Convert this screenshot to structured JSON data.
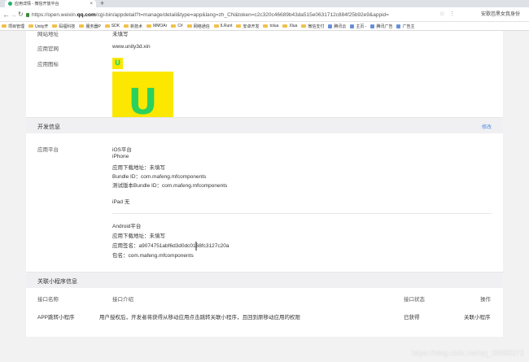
{
  "browser": {
    "tab_title": "应用详情 - 微信开放平台",
    "tab_close": "×",
    "new_tab": "+",
    "url_prefix": "https://open.weixin.",
    "url_domain": "qq.com",
    "url_rest": "/cgi-bin/appdetail?t=manage/detail&type=app&lang=zh_CN&token=c2c320c46689b43da515e0631712c884f25b92e9&appid=",
    "ext_button": "安歌芭黑女我身份",
    "bookmarks": [
      "项目管理",
      "Unity开",
      "码福科技",
      "服务器P",
      "SDK",
      "新技术",
      "MMOAr",
      "C#",
      "网络通信",
      "ILRunt",
      "安卓开发",
      "tolua",
      "Xlua",
      "微信支付",
      "腾讯云",
      "主页 -",
      "腾讯广告",
      "广告主"
    ]
  },
  "basic_info": {
    "partial_label": "网站地址",
    "partial_value": "未填写",
    "site_label": "应用官网",
    "site_value": "www.unity3d.xin",
    "icon_label": "应用图标",
    "icon_letter": "U"
  },
  "dev_info": {
    "section_title": "开发信息",
    "edit_link": "修改",
    "platform_label": "应用平台",
    "ios": {
      "title": "iOS平台",
      "iphone": "iPhone",
      "download": "应用下载地址：未填写",
      "bundle_id": "Bundle ID：com.mafeng.mfcomponents",
      "test_bundle_id": "测试版本Bundle ID：com.mafeng.mfcomponents",
      "ipad": "iPad 无"
    },
    "android": {
      "title": "Android平台",
      "download": "应用下载地址：未填写",
      "signature": "应用签名：a9074751abf6d3d0dc0168fc3127c20a",
      "package": "包名：com.mafeng.mfcomponents"
    }
  },
  "mini_program": {
    "section_title": "关联小程序信息",
    "headers": {
      "name": "接口名称",
      "intro": "接口介绍",
      "status": "接口状态",
      "action": "操作"
    },
    "rows": [
      {
        "name": "APP跳转小程序",
        "intro": "用户授权后，开发者将获得从移动应用点击跳转关联小程序，且回到原移动应用的权限",
        "status": "已获得",
        "action": "关联小程序"
      }
    ]
  },
  "watermark": "https://blog.csdn.net/qq_39985372",
  "colors": {
    "icon_bg": "#fbe700",
    "icon_letter": "#2bd15c",
    "link": "#4b8ae6",
    "section_bg": "#f0f0f2"
  }
}
